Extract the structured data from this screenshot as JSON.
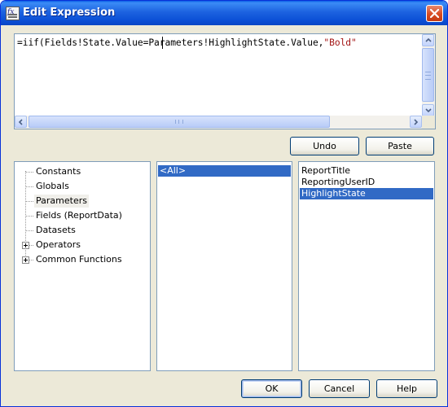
{
  "window": {
    "title": "Edit Expression"
  },
  "editor": {
    "text_before_caret": "=iif(Fields!State.Valu",
    "text_after_caret": "e=Parameters!HighlightState.Value,",
    "string_literal": "\"Bold\""
  },
  "buttons": {
    "undo": "Undo",
    "paste": "Paste",
    "ok": "OK",
    "cancel": "Cancel",
    "help": "Help"
  },
  "categories": [
    {
      "label": "Constants",
      "expandable": false,
      "selected": false
    },
    {
      "label": "Globals",
      "expandable": false,
      "selected": false
    },
    {
      "label": "Parameters",
      "expandable": false,
      "selected": true
    },
    {
      "label": "Fields (ReportData)",
      "expandable": false,
      "selected": false
    },
    {
      "label": "Datasets",
      "expandable": false,
      "selected": false
    },
    {
      "label": "Operators",
      "expandable": true,
      "selected": false
    },
    {
      "label": "Common Functions",
      "expandable": true,
      "selected": false
    }
  ],
  "middle_list": {
    "items": [
      "<All>"
    ],
    "selected_index": 0
  },
  "right_list": {
    "items": [
      "ReportTitle",
      "ReportingUserID",
      "HighlightState"
    ],
    "selected_index": 2
  },
  "colors": {
    "selection": "#316ac5",
    "string_literal": "#a31515",
    "title_bar": "#0b4fd6"
  }
}
